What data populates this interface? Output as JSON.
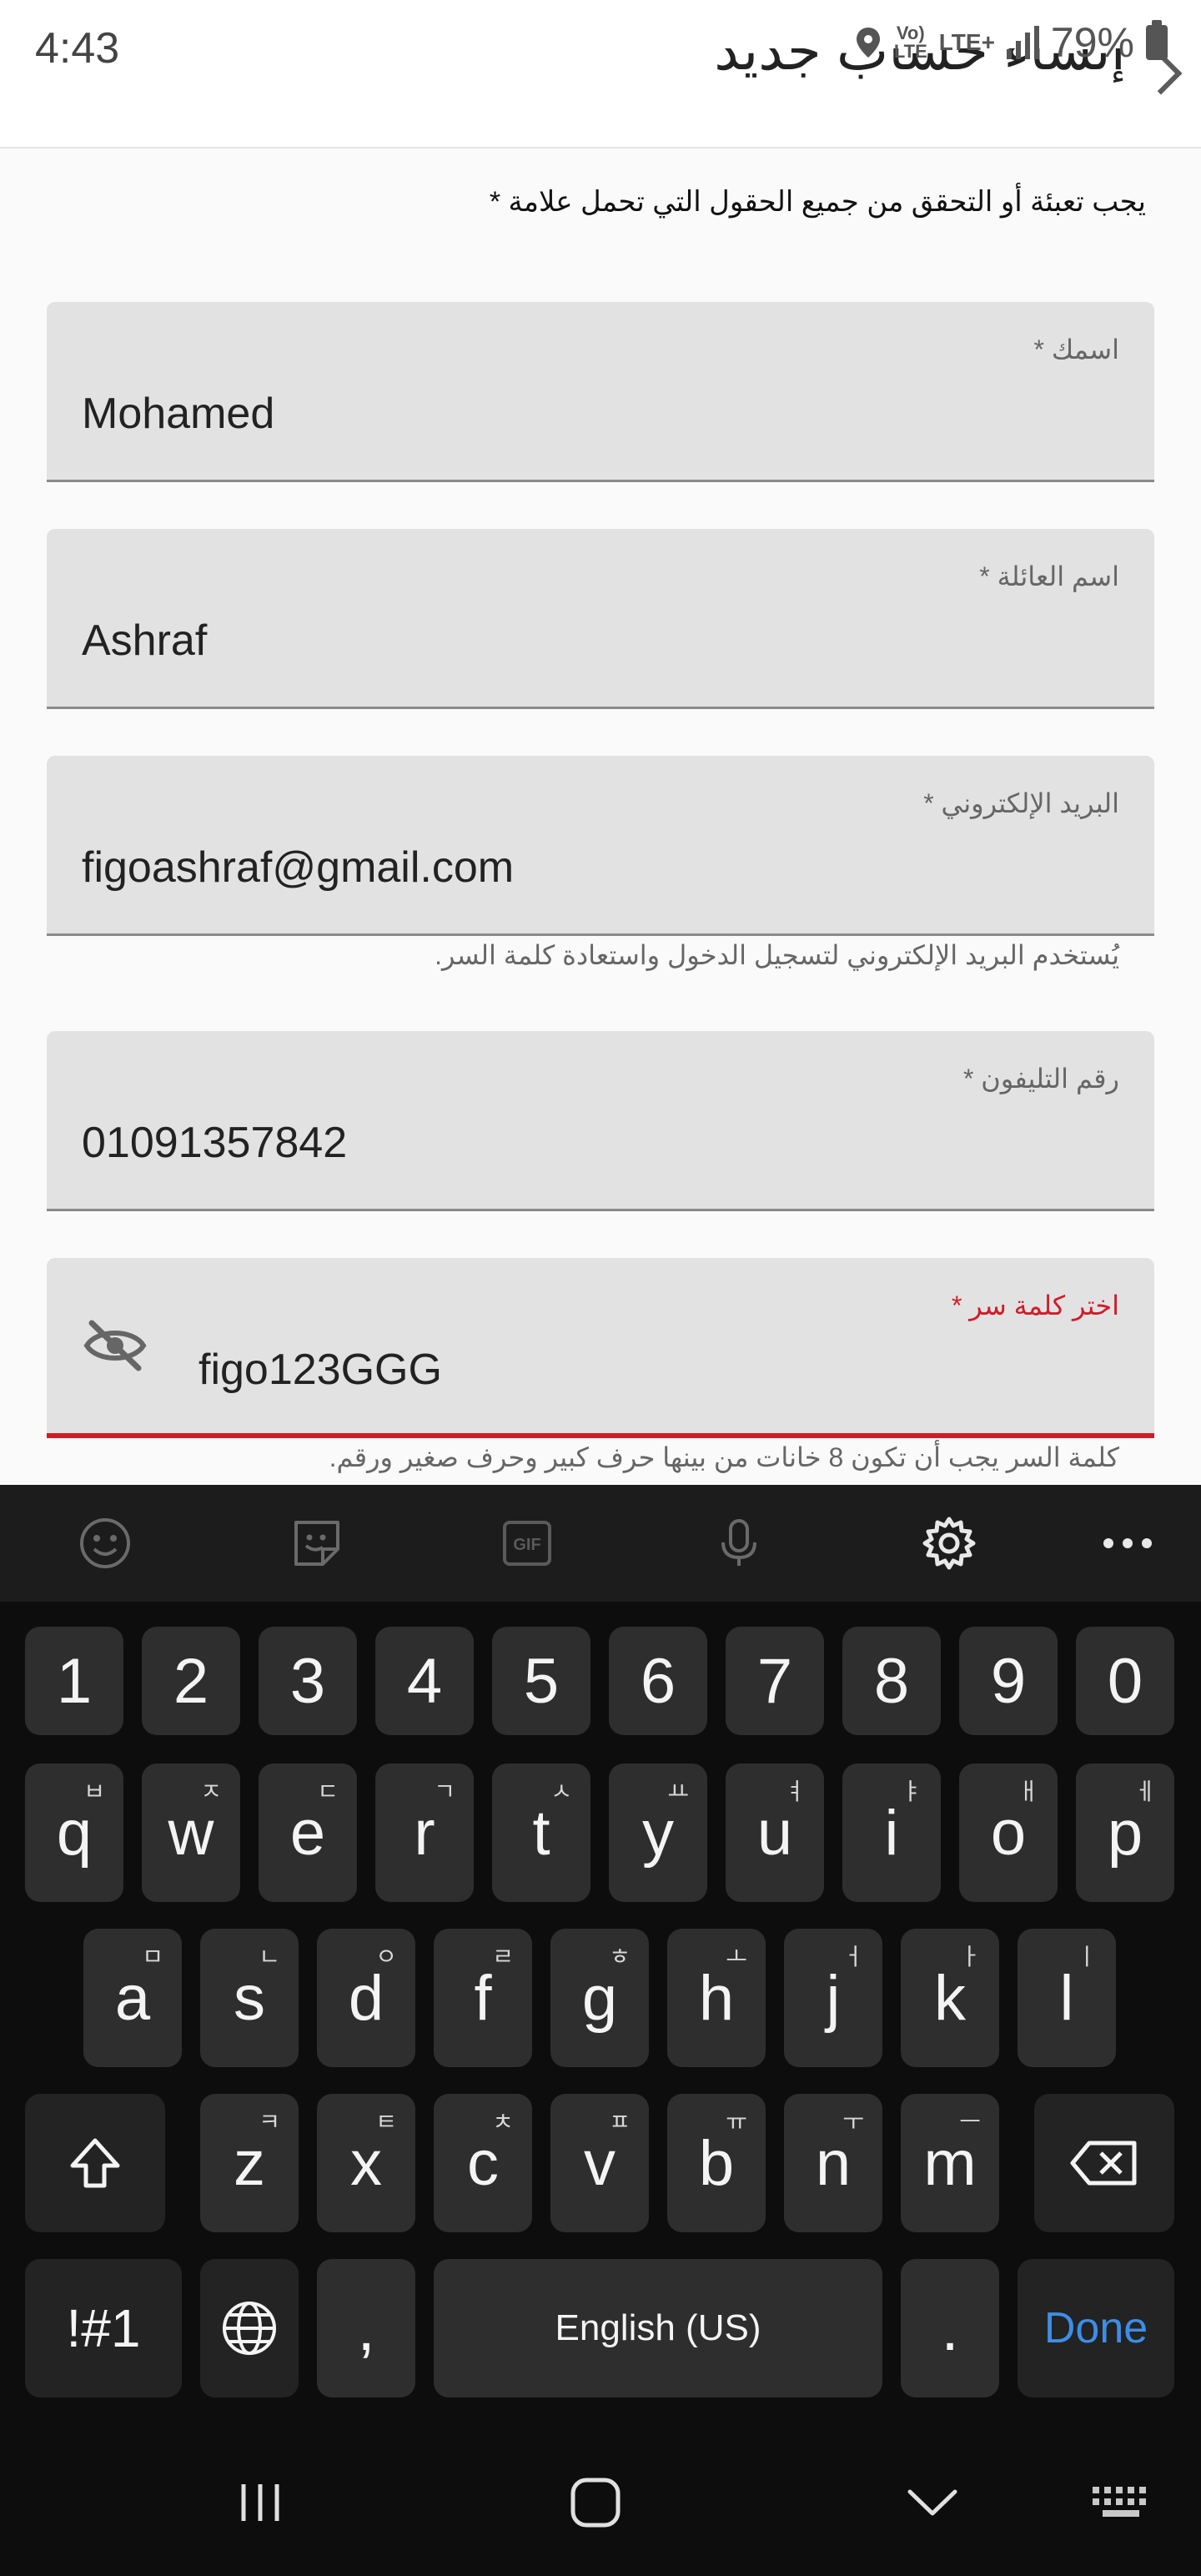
{
  "status_bar": {
    "time": "4:43",
    "network_top": "Vo)",
    "network_bottom": "LTE",
    "lte_plus": "LTE+",
    "battery": "79%"
  },
  "header": {
    "title": "إنشاء حساب جديد"
  },
  "form": {
    "required_note": "يجب تعبئة أو  التحقق من جميع الحقول التي تحمل علامة *",
    "first_name": {
      "label": "اسمك *",
      "value": "Mohamed"
    },
    "last_name": {
      "label": "اسم العائلة *",
      "value": "Ashraf"
    },
    "email": {
      "label": "البريد الإلكتروني *",
      "value": "figoashraf@gmail.com",
      "help": "يُستخدم البريد الإلكتروني لتسجيل الدخول واستعادة كلمة السر."
    },
    "phone": {
      "label": "رقم التليفون *",
      "value": "01091357842"
    },
    "password": {
      "label": "اختر كلمة سر *",
      "value": "figo123GGG",
      "help": "كلمة السر يجب أن تكون 8 خانات من بينها حرف كبير وحرف صغير ورقم.",
      "error_color": "#d01c2a"
    }
  },
  "keyboard": {
    "toolbar": [
      "emoji-icon",
      "sticker-icon",
      "gif-icon",
      "microphone-icon",
      "settings-icon",
      "more-icon"
    ],
    "gif_label": "GIF",
    "number_row": [
      "1",
      "2",
      "3",
      "4",
      "5",
      "6",
      "7",
      "8",
      "9",
      "0"
    ],
    "row1": [
      {
        "key": "q",
        "hint": "ㅂ"
      },
      {
        "key": "w",
        "hint": "ㅈ"
      },
      {
        "key": "e",
        "hint": "ㄷ"
      },
      {
        "key": "r",
        "hint": "ㄱ"
      },
      {
        "key": "t",
        "hint": "ㅅ"
      },
      {
        "key": "y",
        "hint": "ㅛ"
      },
      {
        "key": "u",
        "hint": "ㅕ"
      },
      {
        "key": "i",
        "hint": "ㅑ"
      },
      {
        "key": "o",
        "hint": "ㅐ"
      },
      {
        "key": "p",
        "hint": "ㅔ"
      }
    ],
    "row2": [
      {
        "key": "a",
        "hint": "ㅁ"
      },
      {
        "key": "s",
        "hint": "ㄴ"
      },
      {
        "key": "d",
        "hint": "ㅇ"
      },
      {
        "key": "f",
        "hint": "ㄹ"
      },
      {
        "key": "g",
        "hint": "ㅎ"
      },
      {
        "key": "h",
        "hint": "ㅗ"
      },
      {
        "key": "j",
        "hint": "ㅓ"
      },
      {
        "key": "k",
        "hint": "ㅏ"
      },
      {
        "key": "l",
        "hint": "ㅣ"
      }
    ],
    "row3": [
      {
        "key": "z",
        "hint": "ㅋ"
      },
      {
        "key": "x",
        "hint": "ㅌ"
      },
      {
        "key": "c",
        "hint": "ㅊ"
      },
      {
        "key": "v",
        "hint": "ㅍ"
      },
      {
        "key": "b",
        "hint": "ㅠ"
      },
      {
        "key": "n",
        "hint": "ㅜ"
      },
      {
        "key": "m",
        "hint": "ㅡ"
      }
    ],
    "symbols_label": "!#1",
    "comma_label": ",",
    "space_label": "English (US)",
    "period_label": ".",
    "done_label": "Done",
    "done_color": "#3c8ee8"
  },
  "nav_bar": [
    "recents-icon",
    "home-icon",
    "back-icon",
    "keyboard-icon"
  ]
}
